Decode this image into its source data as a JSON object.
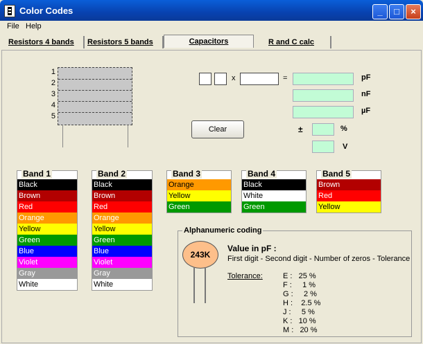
{
  "window": {
    "title": "Color Codes",
    "buttons": [
      "_",
      "□",
      "×"
    ]
  },
  "menu": [
    "File",
    "Help"
  ],
  "tabs": [
    "Resistors 4 bands",
    "Resistors 5 bands",
    "Capacitors",
    "R and C calc"
  ],
  "capacitor": {
    "numbers": [
      "1",
      "2",
      "3",
      "4",
      "5"
    ]
  },
  "calc": {
    "times": "x",
    "equals": "=",
    "units": [
      "pF",
      "nF",
      "µF"
    ],
    "plusminus": "±",
    "percent": "%",
    "volt": "V",
    "clear": "Clear"
  },
  "bands": [
    {
      "label": "Band 1",
      "items": [
        {
          "name": "Black",
          "bg": "#000000",
          "fg": "#ffffff"
        },
        {
          "name": "Brown",
          "bg": "#b20000",
          "fg": "#ffffff"
        },
        {
          "name": "Red",
          "bg": "#ff0000",
          "fg": "#ffffff"
        },
        {
          "name": "Orange",
          "bg": "#ff9900",
          "fg": "#ffffff"
        },
        {
          "name": "Yellow",
          "bg": "#ffff00",
          "fg": "#000000"
        },
        {
          "name": "Green",
          "bg": "#009900",
          "fg": "#ffffff"
        },
        {
          "name": "Blue",
          "bg": "#0000ff",
          "fg": "#ffffff"
        },
        {
          "name": "Violet",
          "bg": "#ff00ff",
          "fg": "#ffffff"
        },
        {
          "name": "Gray",
          "bg": "#999999",
          "fg": "#ffffff"
        },
        {
          "name": "White",
          "bg": "#ffffff",
          "fg": "#000000"
        }
      ]
    },
    {
      "label": "Band 2",
      "items": [
        {
          "name": "Black",
          "bg": "#000000",
          "fg": "#ffffff"
        },
        {
          "name": "Brown",
          "bg": "#b20000",
          "fg": "#ffffff"
        },
        {
          "name": "Red",
          "bg": "#ff0000",
          "fg": "#ffffff"
        },
        {
          "name": "Orange",
          "bg": "#ff9900",
          "fg": "#ffffff"
        },
        {
          "name": "Yellow",
          "bg": "#ffff00",
          "fg": "#000000"
        },
        {
          "name": "Green",
          "bg": "#009900",
          "fg": "#ffffff"
        },
        {
          "name": "Blue",
          "bg": "#0000ff",
          "fg": "#ffffff"
        },
        {
          "name": "Violet",
          "bg": "#ff00ff",
          "fg": "#ffffff"
        },
        {
          "name": "Gray",
          "bg": "#999999",
          "fg": "#ffffff"
        },
        {
          "name": "White",
          "bg": "#ffffff",
          "fg": "#000000"
        }
      ]
    },
    {
      "label": "Band 3",
      "items": [
        {
          "name": "Orange",
          "bg": "#ff9900",
          "fg": "#000000"
        },
        {
          "name": "Yellow",
          "bg": "#ffff00",
          "fg": "#000000"
        },
        {
          "name": "Green",
          "bg": "#009900",
          "fg": "#ffffff"
        }
      ]
    },
    {
      "label": "Band 4",
      "items": [
        {
          "name": "Black",
          "bg": "#000000",
          "fg": "#ffffff"
        },
        {
          "name": "White",
          "bg": "#ffffff",
          "fg": "#000000"
        },
        {
          "name": "Green",
          "bg": "#009900",
          "fg": "#ffffff"
        }
      ]
    },
    {
      "label": "Band 5",
      "items": [
        {
          "name": "Brown",
          "bg": "#b20000",
          "fg": "#ffffff"
        },
        {
          "name": "Red",
          "bg": "#ff0000",
          "fg": "#ffffff"
        },
        {
          "name": "Yellow",
          "bg": "#ffff00",
          "fg": "#000000"
        }
      ]
    }
  ],
  "alpha": {
    "title": "Alphanumeric coding",
    "disc_label": "243K",
    "value_title": "Value in pF :",
    "value_desc": "First digit - Second digit - Number of zeros - Tolerance",
    "tolerance_label": "Tolerance:",
    "tolerances": [
      "E :   25 %",
      "F :     1 %",
      "G :     2 %",
      "H :    2.5 %",
      "J :     5 %",
      "K :   10 %",
      "M :   20 %"
    ]
  }
}
